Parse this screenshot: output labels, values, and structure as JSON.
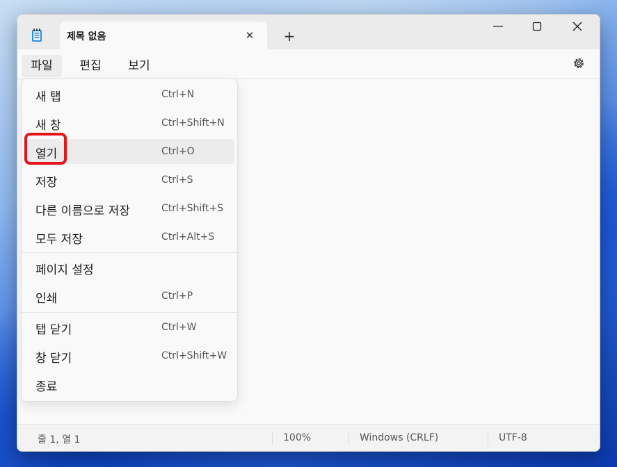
{
  "tab": {
    "title": "제목 없음",
    "close": "✕",
    "add": "+"
  },
  "window_controls": {
    "minimize": "—",
    "maximize": "☐",
    "close": "✕"
  },
  "menubar": {
    "file": "파일",
    "edit": "편집",
    "view": "보기"
  },
  "file_menu": {
    "items": [
      {
        "label": "새 탭",
        "shortcut": "Ctrl+N"
      },
      {
        "label": "새 창",
        "shortcut": "Ctrl+Shift+N"
      },
      {
        "label": "열기",
        "shortcut": "Ctrl+O"
      },
      {
        "label": "저장",
        "shortcut": "Ctrl+S"
      },
      {
        "label": "다른 이름으로 저장",
        "shortcut": "Ctrl+Shift+S"
      },
      {
        "label": "모두 저장",
        "shortcut": "Ctrl+Alt+S"
      },
      {
        "label": "페이지 설정",
        "shortcut": ""
      },
      {
        "label": "인쇄",
        "shortcut": "Ctrl+P"
      },
      {
        "label": "탭 닫기",
        "shortcut": "Ctrl+W"
      },
      {
        "label": "창 닫기",
        "shortcut": "Ctrl+Shift+W"
      },
      {
        "label": "종료",
        "shortcut": ""
      }
    ]
  },
  "statusbar": {
    "position": "줄 1, 열 1",
    "zoom": "100%",
    "line_ending": "Windows (CRLF)",
    "encoding": "UTF-8"
  },
  "icons": {
    "app": "notepad-icon",
    "settings": "gear-icon"
  },
  "colors": {
    "highlight": "#e4141b"
  }
}
